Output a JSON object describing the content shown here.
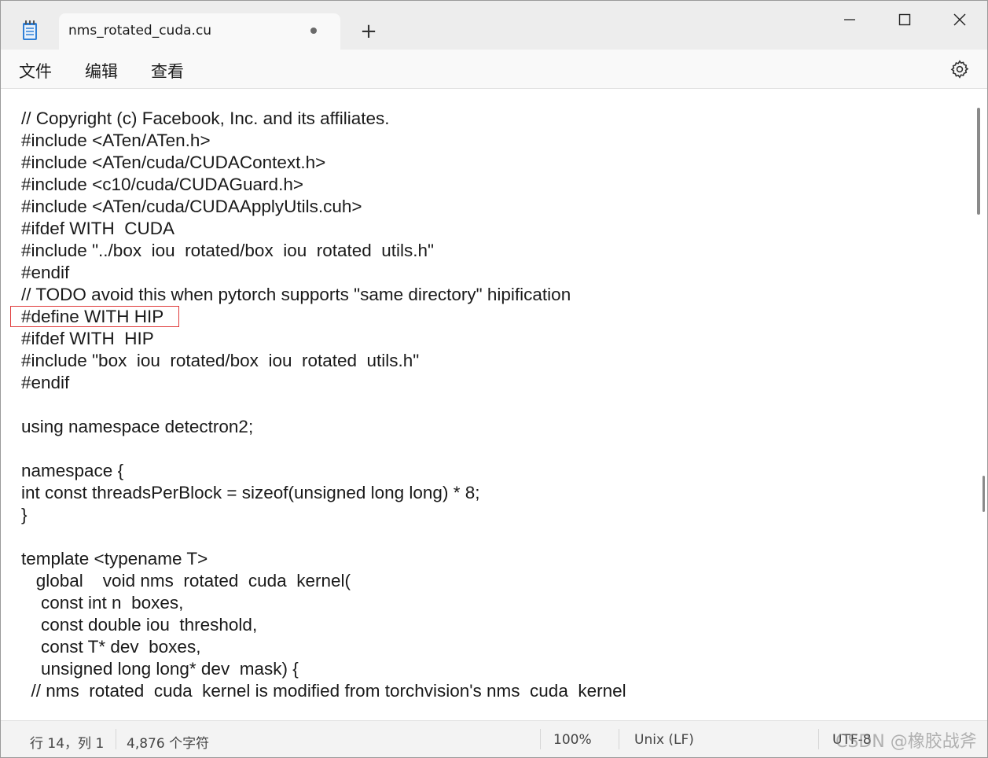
{
  "tab": {
    "title": "nms_rotated_cuda.cu",
    "unsaved_indicator": "●",
    "new_tab_label": "+"
  },
  "window_controls": {
    "minimize": "minimize-icon",
    "maximize": "maximize-icon",
    "close": "close-icon"
  },
  "menu": {
    "file": "文件",
    "edit": "编辑",
    "view": "查看",
    "settings_icon": "gear-icon"
  },
  "editor": {
    "lines": [
      "// Copyright (c) Facebook, Inc. and its affiliates.",
      "#include <ATen/ATen.h>",
      "#include <ATen/cuda/CUDAContext.h>",
      "#include <c10/cuda/CUDAGuard.h>",
      "#include <ATen/cuda/CUDAApplyUtils.cuh>",
      "#ifdef WITH  CUDA",
      "#include \"../box  iou  rotated/box  iou  rotated  utils.h\"",
      "#endif",
      "// TODO avoid this when pytorch supports \"same directory\" hipification",
      "#define WITH HIP",
      "#ifdef WITH  HIP",
      "#include \"box  iou  rotated/box  iou  rotated  utils.h\"",
      "#endif",
      "",
      "using namespace detectron2;",
      "",
      "namespace {",
      "int const threadsPerBlock = sizeof(unsigned long long) * 8;",
      "}",
      "",
      "template <typename T>",
      "   global    void nms  rotated  cuda  kernel(",
      "    const int n  boxes,",
      "    const double iou  threshold,",
      "    const T* dev  boxes,",
      "    unsigned long long* dev  mask) {",
      "  // nms  rotated  cuda  kernel is modified from torchvision's nms  cuda  kernel"
    ]
  },
  "status": {
    "position": "行 14，列 1",
    "char_count": "4,876 个字符",
    "zoom": "100%",
    "line_ending": "Unix (LF)",
    "encoding": "UTF-8"
  },
  "watermark": "CSDN @橡胶战斧",
  "colors": {
    "highlight_border": "#e03a3a",
    "editor_bg": "#ffffff",
    "chrome_bg": "#f3f3f3"
  }
}
